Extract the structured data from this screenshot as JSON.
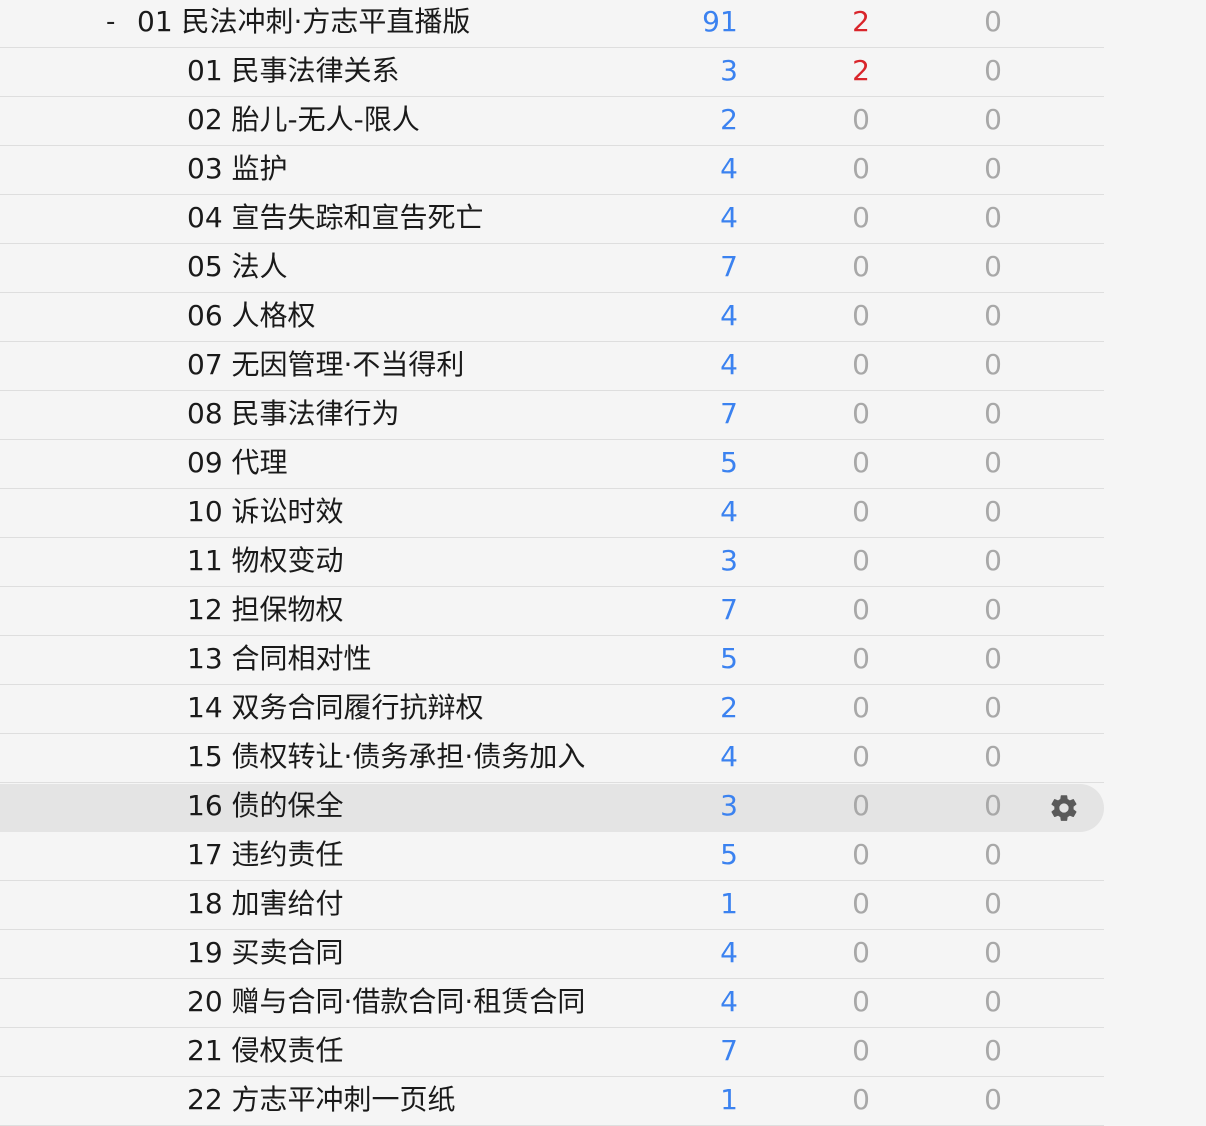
{
  "colors": {
    "new_count": "#3b82f0",
    "learn_count_nonzero": "#d9252b",
    "zero_count": "#a8a8a8",
    "selected_row": "#e4e4e4"
  },
  "parent_deck": {
    "toggle": "-",
    "name": "01 民法冲刺·方志平直播版",
    "new": "91",
    "learn": "2",
    "due": "0"
  },
  "subdecks": [
    {
      "name": "01 民事法律关系",
      "new": "3",
      "learn": "2",
      "due": "0"
    },
    {
      "name": "02 胎儿-无人-限人",
      "new": "2",
      "learn": "0",
      "due": "0"
    },
    {
      "name": "03 监护",
      "new": "4",
      "learn": "0",
      "due": "0"
    },
    {
      "name": "04 宣告失踪和宣告死亡",
      "new": "4",
      "learn": "0",
      "due": "0"
    },
    {
      "name": "05 法人",
      "new": "7",
      "learn": "0",
      "due": "0"
    },
    {
      "name": "06 人格权",
      "new": "4",
      "learn": "0",
      "due": "0"
    },
    {
      "name": "07 无因管理·不当得利",
      "new": "4",
      "learn": "0",
      "due": "0"
    },
    {
      "name": "08 民事法律行为",
      "new": "7",
      "learn": "0",
      "due": "0"
    },
    {
      "name": "09 代理",
      "new": "5",
      "learn": "0",
      "due": "0"
    },
    {
      "name": "10 诉讼时效",
      "new": "4",
      "learn": "0",
      "due": "0"
    },
    {
      "name": "11 物权变动",
      "new": "3",
      "learn": "0",
      "due": "0"
    },
    {
      "name": "12 担保物权",
      "new": "7",
      "learn": "0",
      "due": "0"
    },
    {
      "name": "13 合同相对性",
      "new": "5",
      "learn": "0",
      "due": "0"
    },
    {
      "name": "14 双务合同履行抗辩权",
      "new": "2",
      "learn": "0",
      "due": "0"
    },
    {
      "name": "15 债权转让·债务承担·债务加入",
      "new": "4",
      "learn": "0",
      "due": "0"
    },
    {
      "name": "16 债的保全",
      "new": "3",
      "learn": "0",
      "due": "0",
      "selected": true,
      "gear_icon": "gear-icon"
    },
    {
      "name": "17 违约责任",
      "new": "5",
      "learn": "0",
      "due": "0"
    },
    {
      "name": "18 加害给付",
      "new": "1",
      "learn": "0",
      "due": "0"
    },
    {
      "name": "19 买卖合同",
      "new": "4",
      "learn": "0",
      "due": "0"
    },
    {
      "name": "20 赠与合同·借款合同·租赁合同",
      "new": "4",
      "learn": "0",
      "due": "0"
    },
    {
      "name": "21 侵权责任",
      "new": "7",
      "learn": "0",
      "due": "0"
    },
    {
      "name": "22 方志平冲刺一页纸",
      "new": "1",
      "learn": "0",
      "due": "0"
    }
  ]
}
